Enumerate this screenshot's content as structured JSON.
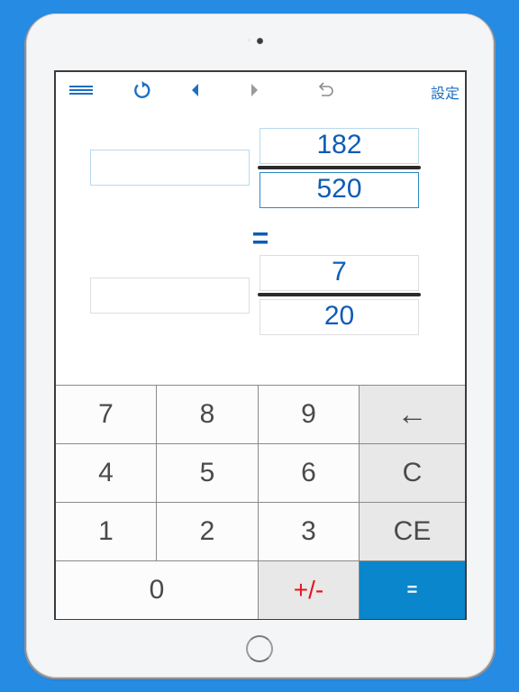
{
  "toolbar": {
    "menu_icon": "menu-icon",
    "refresh_icon": "refresh-icon",
    "prev_icon": "triangle-left-icon",
    "next_icon": "triangle-right-icon",
    "undo_icon": "undo-icon",
    "settings_label": "設定"
  },
  "colors": {
    "background": "#258be3",
    "accent": "#0f5cb5",
    "equals_key": "#0a86cc",
    "sign_key_text": "#e8131b",
    "function_key": "#e8e8e8"
  },
  "fraction_input": {
    "whole": "",
    "numerator": "182",
    "denominator": "520"
  },
  "equals_symbol": "=",
  "fraction_result": {
    "whole": "",
    "numerator": "7",
    "denominator": "20"
  },
  "keypad": {
    "keys": [
      "7",
      "8",
      "9",
      "←",
      "4",
      "5",
      "6",
      "C",
      "1",
      "2",
      "3",
      "CE",
      "0",
      "+/-",
      "="
    ]
  }
}
